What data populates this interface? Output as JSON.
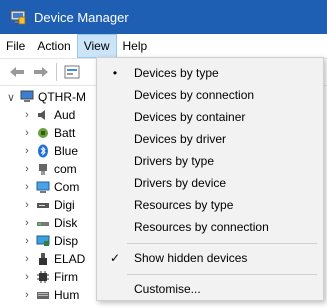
{
  "window": {
    "title": "Device Manager"
  },
  "menubar": {
    "items": [
      "File",
      "Action",
      "View",
      "Help"
    ],
    "open_index": 2
  },
  "tree": {
    "root": "QTHR-M",
    "children": [
      "Aud",
      "Batt",
      "Blue",
      "com",
      "Com",
      "Digi",
      "Disk",
      "Disp",
      "ELAD",
      "Firm",
      "Hum"
    ]
  },
  "view_menu": {
    "group1": [
      {
        "label": "Devices by type",
        "mark": "•"
      },
      {
        "label": "Devices by connection",
        "mark": ""
      },
      {
        "label": "Devices by container",
        "mark": ""
      },
      {
        "label": "Devices by driver",
        "mark": ""
      },
      {
        "label": "Drivers by type",
        "mark": ""
      },
      {
        "label": "Drivers by device",
        "mark": ""
      },
      {
        "label": "Resources by type",
        "mark": ""
      },
      {
        "label": "Resources by connection",
        "mark": ""
      }
    ],
    "group2": [
      {
        "label": "Show hidden devices",
        "mark": "✓"
      }
    ],
    "group3": [
      {
        "label": "Customise...",
        "mark": ""
      }
    ]
  },
  "colors": {
    "titlebar": "#1f5fb3",
    "menu_open_bg": "#cce4f7",
    "dropdown_bg": "#f2f2f2"
  }
}
